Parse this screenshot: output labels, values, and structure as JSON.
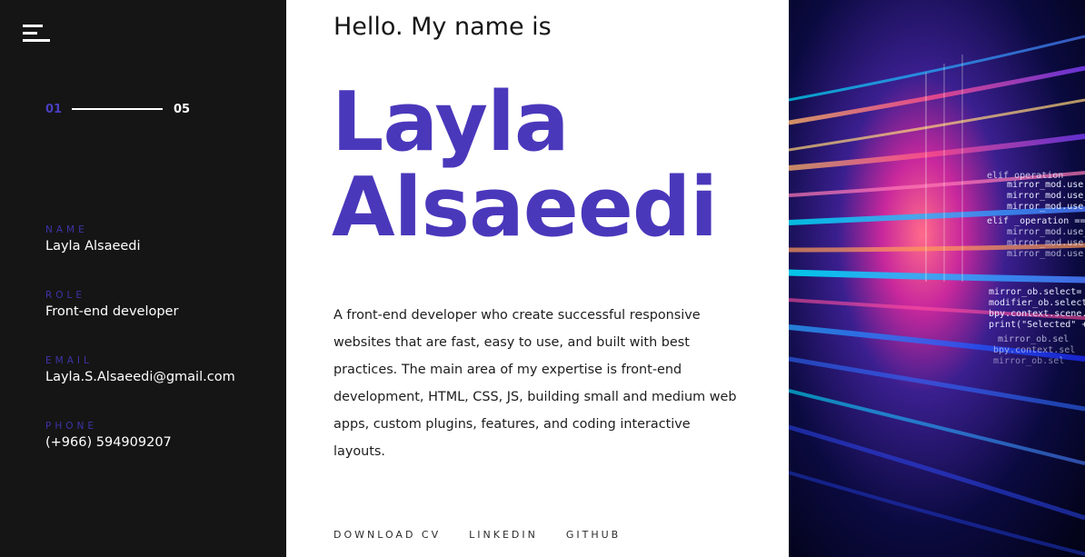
{
  "sidebar": {
    "progress": {
      "current": "01",
      "total": "05"
    },
    "info": [
      {
        "label": "NAME",
        "value": "Layla Alsaeedi"
      },
      {
        "label": "ROLE",
        "value": "Front-end developer"
      },
      {
        "label": "EMAIL",
        "value": "Layla.S.Alsaeedi@gmail.com"
      },
      {
        "label": "PHONE",
        "value": "(+966) 594909207"
      }
    ]
  },
  "main": {
    "greeting": "Hello. My name is",
    "first_name": "Layla",
    "last_name": "Alsaeedi",
    "bio": "A front-end developer who create successful responsive websites that are fast, easy to use, and built with best practices. The main area of my expertise is front-end development, HTML, CSS, JS, building small and medium web apps, custom plugins, features, and coding interactive layouts.",
    "links": {
      "download_cv": "DOWNLOAD CV",
      "linkedin": "LINKEDIN",
      "github": "GITHUB"
    }
  },
  "colors": {
    "sidebar_bg": "#151515",
    "accent": "#4a38bb",
    "label_accent": "#3d33a6"
  },
  "icons": {
    "menu": "hamburger-menu-icon"
  }
}
